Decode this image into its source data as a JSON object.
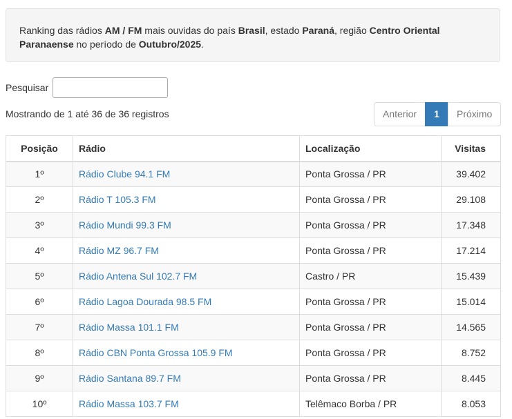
{
  "info": {
    "t1": "Ranking das rádios ",
    "b1": "AM / FM",
    "t2": " mais ouvidas do país ",
    "b2": "Brasil",
    "t3": ", estado ",
    "b3": "Paraná",
    "t4": ", região ",
    "b4": "Centro Oriental Paranaense",
    "t5": " no período de ",
    "b5": "Outubro/2025",
    "t6": "."
  },
  "search": {
    "label": "Pesquisar",
    "value": ""
  },
  "count_text": "Mostrando de 1 até 36 de 36 registros",
  "pagination": {
    "prev": "Anterior",
    "current": "1",
    "next": "Próximo"
  },
  "table": {
    "headers": {
      "position": "Posição",
      "radio": "Rádio",
      "location": "Localização",
      "visits": "Visitas"
    },
    "rows": [
      {
        "position": "1º",
        "radio": "Rádio Clube 94.1 FM",
        "location": "Ponta Grossa / PR",
        "visits": "39.402"
      },
      {
        "position": "2º",
        "radio": "Rádio T 105.3 FM",
        "location": "Ponta Grossa / PR",
        "visits": "29.108"
      },
      {
        "position": "3º",
        "radio": "Rádio Mundi 99.3 FM",
        "location": "Ponta Grossa / PR",
        "visits": "17.348"
      },
      {
        "position": "4º",
        "radio": "Rádio MZ 96.7 FM",
        "location": "Ponta Grossa / PR",
        "visits": "17.214"
      },
      {
        "position": "5º",
        "radio": "Rádio Antena Sul 102.7 FM",
        "location": "Castro / PR",
        "visits": "15.439"
      },
      {
        "position": "6º",
        "radio": "Rádio Lagoa Dourada 98.5 FM",
        "location": "Ponta Grossa / PR",
        "visits": "15.014"
      },
      {
        "position": "7º",
        "radio": "Rádio Massa 101.1 FM",
        "location": "Ponta Grossa / PR",
        "visits": "14.565"
      },
      {
        "position": "8º",
        "radio": "Rádio CBN Ponta Grossa 105.9 FM",
        "location": "Ponta Grossa / PR",
        "visits": "8.752"
      },
      {
        "position": "9º",
        "radio": "Rádio Santana 89.7 FM",
        "location": "Ponta Grossa / PR",
        "visits": "8.445"
      },
      {
        "position": "10º",
        "radio": "Rádio Massa 103.7 FM",
        "location": "Telêmaco Borba / PR",
        "visits": "8.053"
      }
    ]
  }
}
